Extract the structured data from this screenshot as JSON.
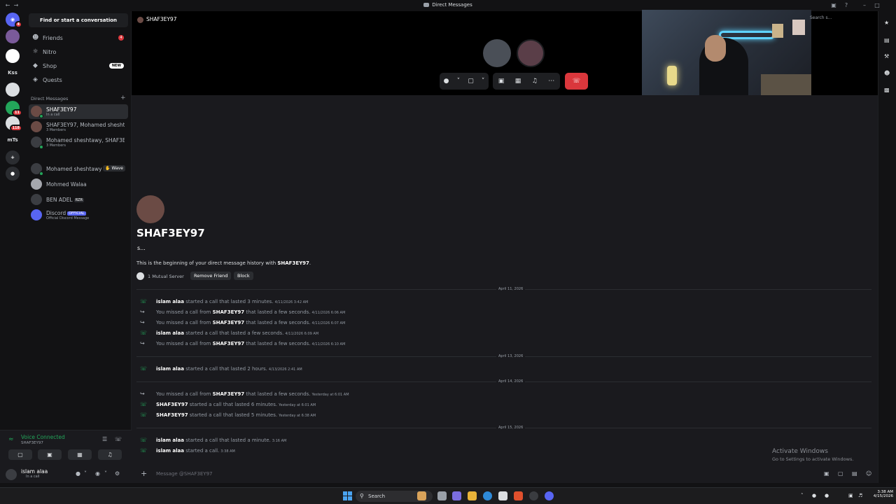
{
  "window": {
    "title": "Direct Messages"
  },
  "rail": {
    "servers": [
      {
        "label": "",
        "icon": "discord-home-icon",
        "badge": "4"
      },
      {
        "label": "",
        "icon": "server-avatar-icon",
        "badge": ""
      },
      {
        "label": "",
        "icon": "server-avatar-icon",
        "badge": ""
      },
      {
        "label": "Kss",
        "icon": "",
        "badge": ""
      },
      {
        "label": "",
        "icon": "server-avatar-icon",
        "badge": ""
      },
      {
        "label": "",
        "icon": "server-avatar-icon",
        "badge": "11"
      },
      {
        "label": "",
        "icon": "server-avatar-icon",
        "badge": "118"
      },
      {
        "label": "mTs",
        "icon": "",
        "badge": ""
      }
    ],
    "badges": {
      "home": "4",
      "s6": "11",
      "s7": "118"
    },
    "kss": "Kss",
    "mts": "mTs"
  },
  "sidebar": {
    "find": "Find or start a conversation",
    "nav": {
      "friends": "Friends",
      "friends_badge": "4",
      "nitro": "Nitro",
      "shop": "Shop",
      "shop_badge": "NEW",
      "quests": "Quests"
    },
    "dm_header": "Direct Messages",
    "dms": {
      "d1": {
        "name": "SHAF3EY97",
        "sub": "In a call"
      },
      "d2": {
        "name": "SHAF3EY97, Mohamed sheshta...",
        "sub": "3 Members"
      },
      "d3": {
        "name": "Mohamed sheshtawy, SHAF3E...",
        "sub": "3 Members"
      },
      "d4": {
        "name": "Mohamed sheshtawy",
        "wave": "Wave"
      },
      "d5": {
        "name": "Mohmed Walaa"
      },
      "d6": {
        "name": "BEN ADEL",
        "tag": "RZR"
      },
      "d7": {
        "name": "Discord",
        "tag": "OFFICIAL",
        "sub": "Official Discord Message"
      }
    }
  },
  "voice": {
    "status": "Voice Connected",
    "channel": "SHAF3EY97"
  },
  "user": {
    "name": "islam alaa",
    "status": "In a call"
  },
  "stage": {
    "title": "SHAF3EY97"
  },
  "right": {
    "search_placeholder": "Search s..."
  },
  "chat": {
    "profile_name": "SHAF3EY97",
    "profile_sub": "s...",
    "begin_prefix": "This is the beginning of your direct message history with ",
    "begin_name": "SHAF3EY97",
    "begin_suffix": ".",
    "mutual": "1 Mutual Server",
    "remove_friend": "Remove Friend",
    "block": "Block",
    "days": {
      "d1": "April 11, 2026",
      "d2": "April 13, 2026",
      "d3": "April 14, 2026",
      "d4": "April 15, 2026"
    },
    "msgs": {
      "m1": {
        "who": "islam alaa",
        "text": " started a call that lasted 3 minutes.",
        "ts": "4/11/2026 3:42 AM"
      },
      "m2": {
        "pre": "You missed a call from ",
        "who": "SHAF3EY97",
        "text": " that lasted a few seconds.",
        "ts": "4/11/2026 6:06 AM"
      },
      "m3": {
        "pre": "You missed a call from ",
        "who": "SHAF3EY97",
        "text": " that lasted a few seconds.",
        "ts": "4/11/2026 6:07 AM"
      },
      "m4": {
        "who": "islam alaa",
        "text": " started a call that lasted a few seconds.",
        "ts": "4/11/2026 6:09 AM"
      },
      "m5": {
        "pre": "You missed a call from ",
        "who": "SHAF3EY97",
        "text": " that lasted a few seconds.",
        "ts": "4/11/2026 6:10 AM"
      },
      "m6": {
        "who": "islam alaa",
        "text": " started a call that lasted 2 hours.",
        "ts": "4/13/2026 2:41 AM"
      },
      "m7": {
        "pre": "You missed a call from ",
        "who": "SHAF3EY97",
        "text": " that lasted a few seconds.",
        "ts": "Yesterday at 6:01 AM"
      },
      "m8": {
        "who": "SHAF3EY97",
        "text": " started a call that lasted 6 minutes.",
        "ts": "Yesterday at 6:01 AM"
      },
      "m9": {
        "who": "SHAF3EY97",
        "text": " started a call that lasted 5 minutes.",
        "ts": "Yesterday at 6:38 AM"
      },
      "m10": {
        "who": "islam alaa",
        "text": " started a call that lasted a minute.",
        "ts": "3:16 AM"
      },
      "m11": {
        "who": "islam alaa",
        "text": " started a call.",
        "ts": "3:38 AM"
      }
    },
    "composer_placeholder": "Message @SHAF3EY97"
  },
  "watermark": {
    "line1": "Activate Windows",
    "line2": "Go to Settings to activate Windows."
  },
  "taskbar": {
    "search": "Search",
    "time": "3:38 AM",
    "date": "4/15/2026"
  },
  "colors": {
    "accent": "#5865f2",
    "green": "#23a55a",
    "red": "#da373c",
    "bg": "#1a1a1e"
  }
}
